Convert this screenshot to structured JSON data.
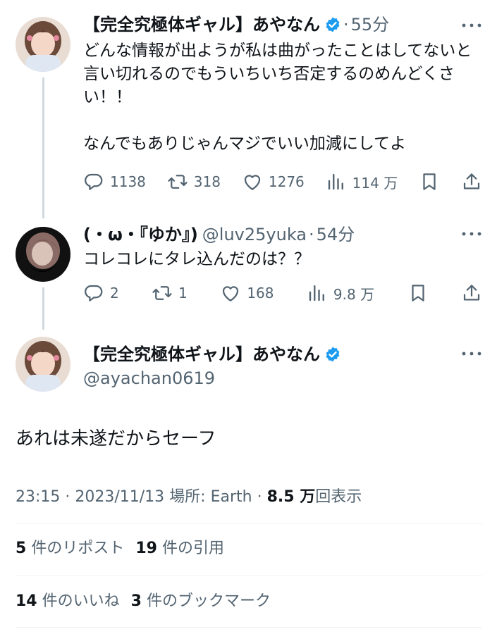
{
  "tweet1": {
    "name": "【完全究極体ギャル】あやなん",
    "separator": "·",
    "time": "55分",
    "text": "どんな情報が出ようが私は曲がったことはしてないと言い切れるのでもういちいち否定するのめんどくさい！！\n\nなんでもありじゃんマジでいい加減にしてよ",
    "replies": "1138",
    "retweets": "318",
    "likes": "1276",
    "views": "114 万"
  },
  "tweet2": {
    "name": "(・ω・『ゆか』)",
    "handle": "@luv25yuka",
    "separator": "·",
    "time": "54分",
    "text": "コレコレにタレ込んだのは？？",
    "replies": "2",
    "retweets": "1",
    "likes": "168",
    "views": "9.8 万"
  },
  "main": {
    "name": "【完全究極体ギャル】あやなん",
    "handle": "@ayachan0619",
    "text": "あれは未遂だからセーフ",
    "meta_prefix": "23:15 · 2023/11/13 場所: Earth · ",
    "views_count": "8.5 万",
    "views_suffix": "回表示",
    "reposts_count": "5",
    "reposts_label": "件のリポスト",
    "quotes_count": "19",
    "quotes_label": "件の引用",
    "likes_count": "14",
    "likes_label": "件のいいね",
    "bookmarks_count": "3",
    "bookmarks_label": "件のブックマーク"
  },
  "colors": {
    "verified": "#1d9bf0",
    "secondary_text": "#536471",
    "thread_line": "#cfd9de"
  },
  "icons": {
    "reply": "reply-icon",
    "retweet": "retweet-icon",
    "like": "heart-icon",
    "views": "bar-chart-icon",
    "bookmark": "bookmark-icon",
    "share": "share-icon",
    "more": "more-icon",
    "verified": "verified-badge-icon"
  }
}
